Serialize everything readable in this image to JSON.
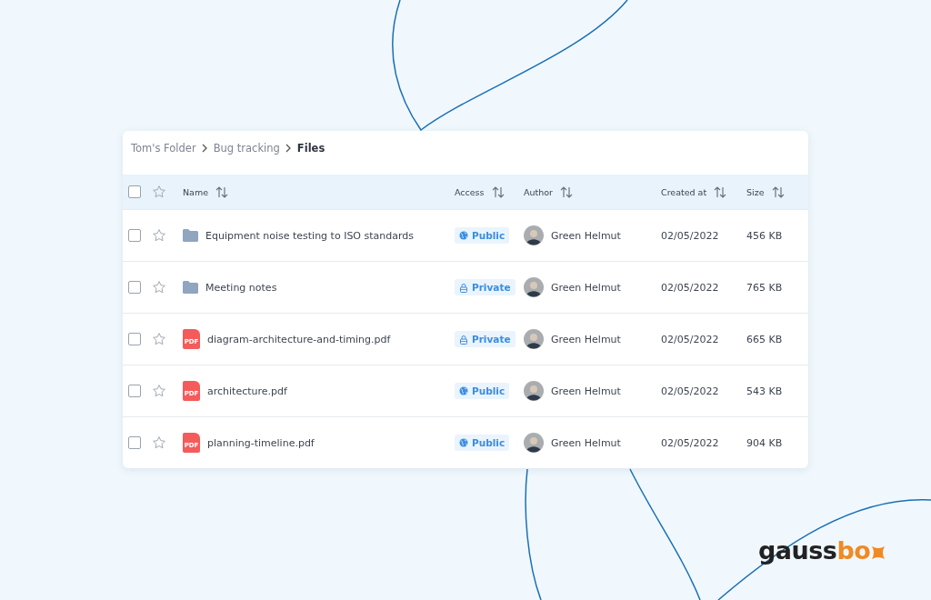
{
  "breadcrumb": [
    {
      "label": "Tom's Folder",
      "current": false
    },
    {
      "label": "Bug tracking",
      "current": false
    },
    {
      "label": "Files",
      "current": true
    }
  ],
  "table": {
    "select_all": {
      "checked": false
    },
    "header_star": {
      "starred": false
    },
    "columns": [
      {
        "label": "Name"
      },
      {
        "label": "Access"
      },
      {
        "label": "Author"
      },
      {
        "label": "Created at"
      },
      {
        "label": "Size"
      }
    ],
    "rows": [
      {
        "checked": false,
        "starred": false,
        "kind": "folder",
        "name": "Equipment noise testing to ISO standards",
        "access": {
          "kind": "public",
          "label": "Public"
        },
        "author": "Green Helmut",
        "created": "02/05/2022",
        "size": "456 KB"
      },
      {
        "checked": false,
        "starred": false,
        "kind": "folder",
        "name": "Meeting notes",
        "access": {
          "kind": "private",
          "label": "Private"
        },
        "author": "Green Helmut",
        "created": "02/05/2022",
        "size": "765 KB"
      },
      {
        "checked": false,
        "starred": false,
        "kind": "pdf",
        "icon_label": "PDF",
        "name": "diagram-architecture-and-timing.pdf",
        "access": {
          "kind": "private",
          "label": "Private"
        },
        "author": "Green Helmut",
        "created": "02/05/2022",
        "size": "665 KB"
      },
      {
        "checked": false,
        "starred": false,
        "kind": "pdf",
        "icon_label": "PDF",
        "name": "architecture.pdf",
        "access": {
          "kind": "public",
          "label": "Public"
        },
        "author": "Green Helmut",
        "created": "02/05/2022",
        "size": "543 KB"
      },
      {
        "checked": false,
        "starred": false,
        "kind": "pdf",
        "icon_label": "PDF",
        "name": "planning-timeline.pdf",
        "access": {
          "kind": "public",
          "label": "Public"
        },
        "author": "Green Helmut",
        "created": "02/05/2022",
        "size": "904 KB"
      }
    ]
  },
  "logo": {
    "part_1": "gauss",
    "part_2": "bo"
  }
}
